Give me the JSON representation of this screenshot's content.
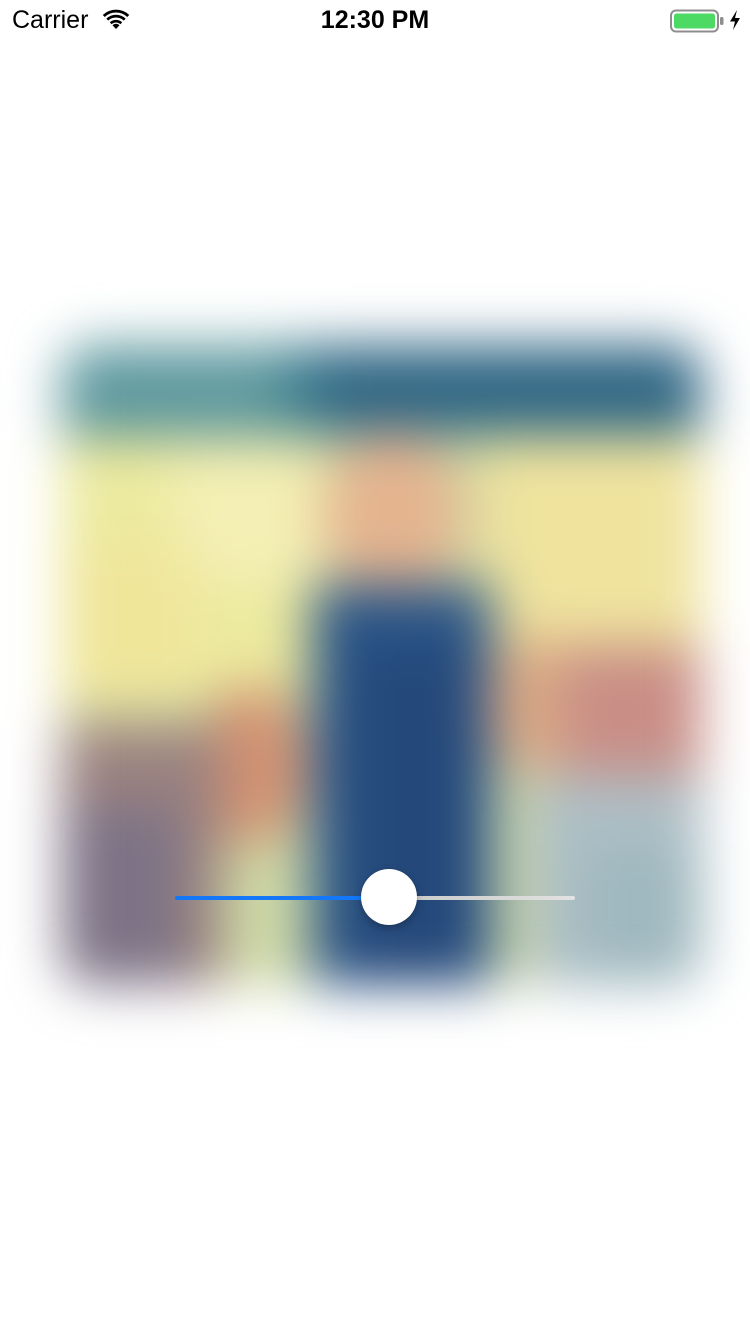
{
  "status_bar": {
    "carrier": "Carrier",
    "time": "12:30 PM",
    "wifi_icon": "wifi-icon",
    "battery_icon": "battery-icon",
    "charging_icon": "charging-bolt-icon",
    "battery_color": "#4cd964"
  },
  "photo": {
    "description_icon": "blurred-photo",
    "blurred": true
  },
  "slider": {
    "value": 0.54,
    "min_track_color": "#1477f8",
    "max_track_color": "#d0d0d0",
    "thumb_color": "#ffffff"
  }
}
